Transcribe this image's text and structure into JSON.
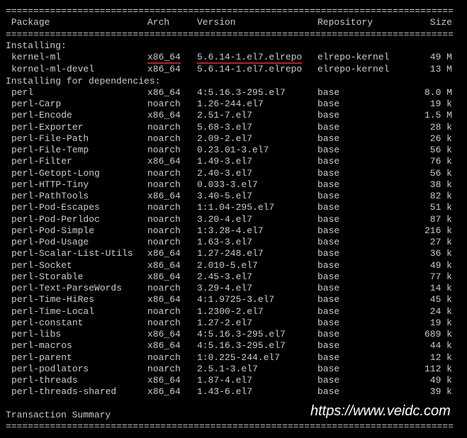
{
  "rule": "=================================================================================",
  "headers": {
    "package": "Package",
    "arch": "Arch",
    "version": "Version",
    "repository": "Repository",
    "size": "Size"
  },
  "sections": [
    {
      "title": "Installing:",
      "rows": [
        {
          "package": "kernel-ml",
          "arch": "x86_64",
          "version": "5.6.14-1.el7.elrepo",
          "repo": "elrepo-kernel",
          "size": "49 M",
          "hl": true
        },
        {
          "package": "kernel-ml-devel",
          "arch": "x86_64",
          "version": "5.6.14-1.el7.elrepo",
          "repo": "elrepo-kernel",
          "size": "13 M"
        }
      ]
    },
    {
      "title": "Installing for dependencies:",
      "rows": [
        {
          "package": "perl",
          "arch": "x86_64",
          "version": "4:5.16.3-295.el7",
          "repo": "base",
          "size": "8.0 M"
        },
        {
          "package": "perl-Carp",
          "arch": "noarch",
          "version": "1.26-244.el7",
          "repo": "base",
          "size": "19 k"
        },
        {
          "package": "perl-Encode",
          "arch": "x86_64",
          "version": "2.51-7.el7",
          "repo": "base",
          "size": "1.5 M"
        },
        {
          "package": "perl-Exporter",
          "arch": "noarch",
          "version": "5.68-3.el7",
          "repo": "base",
          "size": "28 k"
        },
        {
          "package": "perl-File-Path",
          "arch": "noarch",
          "version": "2.09-2.el7",
          "repo": "base",
          "size": "26 k"
        },
        {
          "package": "perl-File-Temp",
          "arch": "noarch",
          "version": "0.23.01-3.el7",
          "repo": "base",
          "size": "56 k"
        },
        {
          "package": "perl-Filter",
          "arch": "x86_64",
          "version": "1.49-3.el7",
          "repo": "base",
          "size": "76 k"
        },
        {
          "package": "perl-Getopt-Long",
          "arch": "noarch",
          "version": "2.40-3.el7",
          "repo": "base",
          "size": "56 k"
        },
        {
          "package": "perl-HTTP-Tiny",
          "arch": "noarch",
          "version": "0.033-3.el7",
          "repo": "base",
          "size": "38 k"
        },
        {
          "package": "perl-PathTools",
          "arch": "x86_64",
          "version": "3.40-5.el7",
          "repo": "base",
          "size": "82 k"
        },
        {
          "package": "perl-Pod-Escapes",
          "arch": "noarch",
          "version": "1:1.04-295.el7",
          "repo": "base",
          "size": "51 k"
        },
        {
          "package": "perl-Pod-Perldoc",
          "arch": "noarch",
          "version": "3.20-4.el7",
          "repo": "base",
          "size": "87 k"
        },
        {
          "package": "perl-Pod-Simple",
          "arch": "noarch",
          "version": "1:3.28-4.el7",
          "repo": "base",
          "size": "216 k"
        },
        {
          "package": "perl-Pod-Usage",
          "arch": "noarch",
          "version": "1.63-3.el7",
          "repo": "base",
          "size": "27 k"
        },
        {
          "package": "perl-Scalar-List-Utils",
          "arch": "x86_64",
          "version": "1.27-248.el7",
          "repo": "base",
          "size": "36 k"
        },
        {
          "package": "perl-Socket",
          "arch": "x86_64",
          "version": "2.010-5.el7",
          "repo": "base",
          "size": "49 k"
        },
        {
          "package": "perl-Storable",
          "arch": "x86_64",
          "version": "2.45-3.el7",
          "repo": "base",
          "size": "77 k"
        },
        {
          "package": "perl-Text-ParseWords",
          "arch": "noarch",
          "version": "3.29-4.el7",
          "repo": "base",
          "size": "14 k"
        },
        {
          "package": "perl-Time-HiRes",
          "arch": "x86_64",
          "version": "4:1.9725-3.el7",
          "repo": "base",
          "size": "45 k"
        },
        {
          "package": "perl-Time-Local",
          "arch": "noarch",
          "version": "1.2300-2.el7",
          "repo": "base",
          "size": "24 k"
        },
        {
          "package": "perl-constant",
          "arch": "noarch",
          "version": "1.27-2.el7",
          "repo": "base",
          "size": "19 k"
        },
        {
          "package": "perl-libs",
          "arch": "x86_64",
          "version": "4:5.16.3-295.el7",
          "repo": "base",
          "size": "689 k"
        },
        {
          "package": "perl-macros",
          "arch": "x86_64",
          "version": "4:5.16.3-295.el7",
          "repo": "base",
          "size": "44 k"
        },
        {
          "package": "perl-parent",
          "arch": "noarch",
          "version": "1:0.225-244.el7",
          "repo": "base",
          "size": "12 k"
        },
        {
          "package": "perl-podlators",
          "arch": "noarch",
          "version": "2.5.1-3.el7",
          "repo": "base",
          "size": "112 k"
        },
        {
          "package": "perl-threads",
          "arch": "x86_64",
          "version": "1.87-4.el7",
          "repo": "base",
          "size": "49 k"
        },
        {
          "package": "perl-threads-shared",
          "arch": "x86_64",
          "version": "1.43-6.el7",
          "repo": "base",
          "size": "39 k"
        }
      ]
    }
  ],
  "summary": "Transaction Summary",
  "watermark": "https://www.veidc.com"
}
